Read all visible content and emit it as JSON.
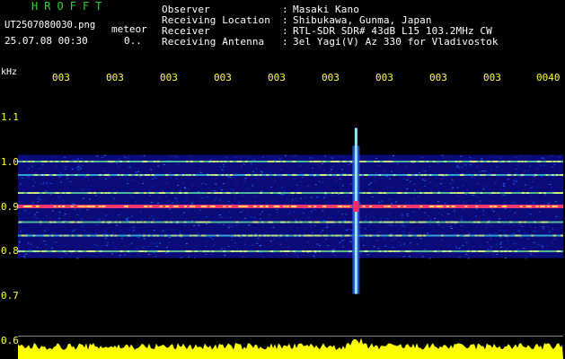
{
  "header": {
    "brand": "HROFFT",
    "filename": "UT2507080030.png",
    "meteor_label": "meteor",
    "datetime": "25.07.08 00:30",
    "count": "0..",
    "fields": [
      {
        "label": "Observer",
        "sep": ":",
        "value": "Masaki Kano"
      },
      {
        "label": "Receiving Location",
        "sep": ":",
        "value": "Shibukawa, Gunma, Japan"
      },
      {
        "label": "Receiver",
        "sep": ":",
        "value": "RTL-SDR SDR# 43dB L15 103.2MHz CW"
      },
      {
        "label": "Receiving Antenna",
        "sep": ":",
        "value": "3el Yagi(V) Az 330 for Vladivostok"
      }
    ]
  },
  "spectrogram": {
    "unit_label": "kHz",
    "time_ticks": [
      "003",
      "003",
      "003",
      "003",
      "003",
      "003",
      "003",
      "003",
      "003",
      "0040"
    ],
    "freq_ticks": [
      "1.1",
      "1.0",
      "0.9",
      "0.8",
      "0.7",
      "0.6"
    ],
    "freq_range_khz": [
      0.6,
      1.15
    ],
    "band_khz": [
      0.785,
      1.015
    ],
    "noise_lines_khz": [
      1.0,
      0.97,
      0.93,
      0.9,
      0.865,
      0.835,
      0.8
    ],
    "meteor_time_fraction": 0.62,
    "colors": {
      "background": "#000000",
      "tick_text": "#ffff3a",
      "brand": "#2cd12c",
      "signal_peak": "#ff3b6b",
      "audio_level": "#ffff00"
    }
  }
}
